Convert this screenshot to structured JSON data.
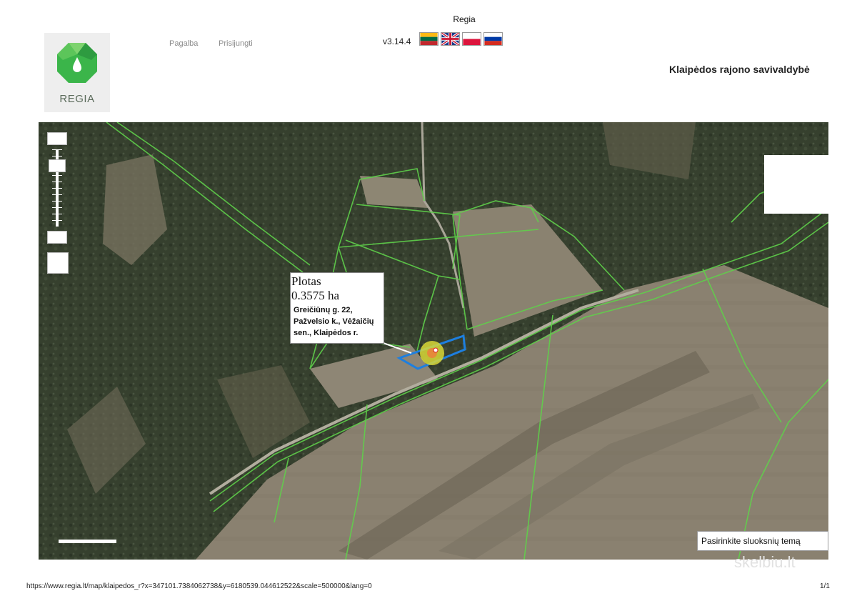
{
  "header": {
    "title": "Regia",
    "nav": [
      "Pagalba",
      "Prisijungti"
    ],
    "version": "v3.14.4",
    "languages": [
      "lt-flag-icon",
      "gb-flag-icon",
      "pl-flag-icon",
      "ru-flag-icon"
    ],
    "municipality": "Klaipėdos rajono savivaldybė"
  },
  "logo": {
    "text": "REGIA",
    "color": "#3bb54a"
  },
  "map": {
    "info_box": {
      "area_label": "Plotas",
      "area_value": "0.3575 ha",
      "address_lines": [
        "Greičiūnų g. 22,",
        "Pažvelsio k., Vėžaičių",
        "sen., Klaipėdos r."
      ]
    },
    "layer_select": "Pasirinkite sluoksnių temą",
    "parcel_color": "#1d7fe0",
    "boundary_color": "#5fd14a"
  },
  "footer": {
    "url": "https://www.regia.lt/map/klaipedos_r?x=347101.7384062738&y=6180539.044612522&scale=500000&lang=0",
    "page": "1/1",
    "watermark": "skelbiu.lt"
  }
}
